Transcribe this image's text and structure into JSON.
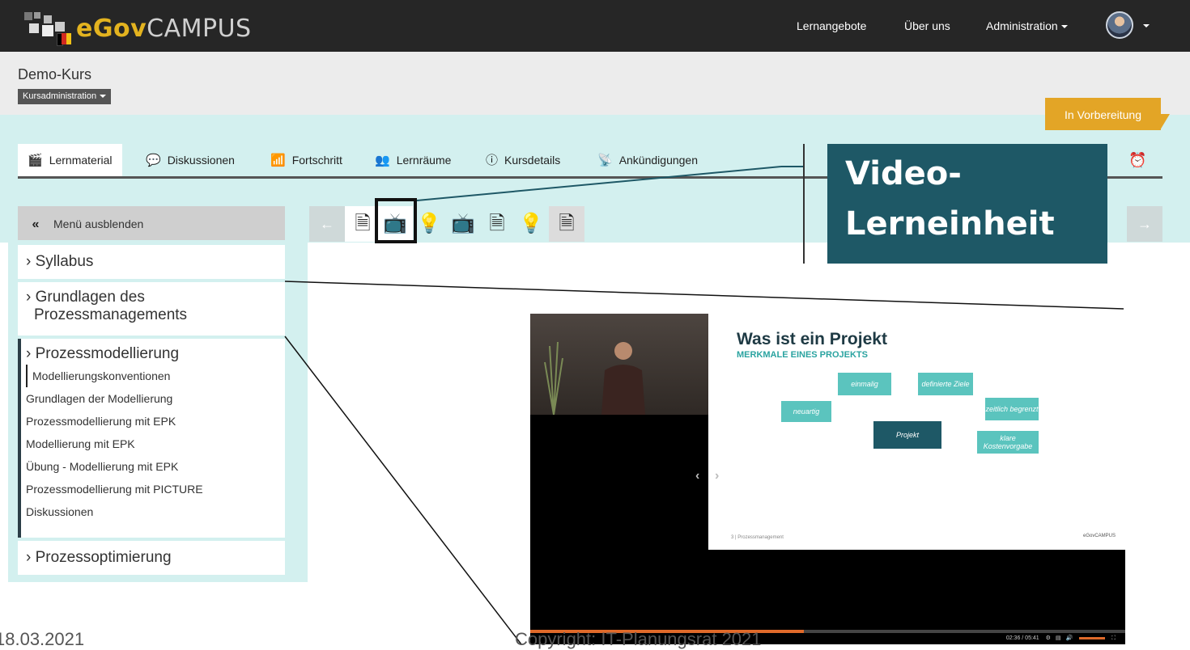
{
  "header": {
    "logo_text_bold": "eGov",
    "logo_text_light": "CAMPUS",
    "menu": {
      "lernangebote": "Lernangebote",
      "ueber_uns": "Über uns",
      "administration": "Administration"
    }
  },
  "course": {
    "title": "Demo-Kurs",
    "admin_dropdown": "Kursadministration",
    "status_badge": "In Vorbereitung"
  },
  "tabs": [
    {
      "label": "Lernmaterial",
      "icon": "clapperboard-icon"
    },
    {
      "label": "Diskussionen",
      "icon": "chat-bubbles-icon"
    },
    {
      "label": "Fortschritt",
      "icon": "progress-chart-icon"
    },
    {
      "label": "Lernräume",
      "icon": "users-icon"
    },
    {
      "label": "Kursdetails",
      "icon": "info-icon"
    },
    {
      "label": "Ankündigungen",
      "icon": "satellite-dish-icon"
    }
  ],
  "sidebar": {
    "hide_menu": "Menü ausblenden",
    "sections": [
      {
        "title": "› Syllabus"
      },
      {
        "title_line1": "› Grundlagen des",
        "title_line2": "Prozessmanagements"
      },
      {
        "title": "› Prozessmodellierung",
        "items": [
          "Modellierungskonventionen",
          "Grundlagen der Modellierung",
          "Prozessmodellierung mit EPK",
          "Modellierung mit EPK",
          "Übung - Modellierung mit EPK",
          "Prozessmodellierung mit PICTURE",
          "Diskussionen"
        ]
      },
      {
        "title": "› Prozessoptimierung"
      }
    ]
  },
  "unit_nav": {
    "prev": "←",
    "next": "→",
    "icons": [
      "document-icon",
      "tv-icon",
      "lightbulb-icon",
      "tv-icon",
      "document-icon",
      "lightbulb-icon",
      "document-icon"
    ]
  },
  "callout": {
    "line1": "Video-",
    "line2": "Lerneinheit"
  },
  "video": {
    "slide_title": "Was ist ein Projekt",
    "slide_subtitle": "MERKMALE EINES PROJEKTS",
    "boxes": {
      "einmalig": "einmalig",
      "definierte": "definierte Ziele",
      "neuartig": "neuartig",
      "zeitlich": "zeitlich begrenzt",
      "projekt": "Projekt",
      "klare": "klare Kostenvorgabe"
    },
    "slide_footer": "3 | Prozessmanagement",
    "slide_logo": "eGovCAMPUS",
    "time": "02:36 / 05:41",
    "progress": 0.46
  },
  "footer": {
    "date": "18.03.2021",
    "copyright": "Copyright: IT-Planungsrat 2021"
  }
}
